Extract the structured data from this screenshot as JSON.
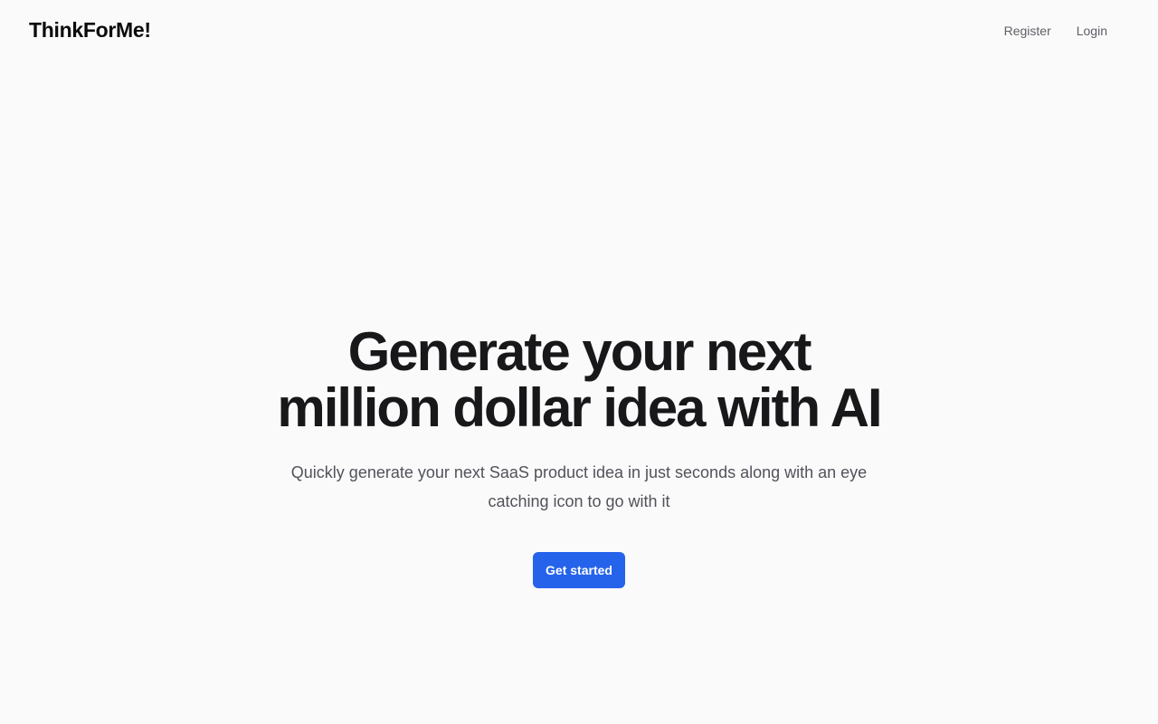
{
  "header": {
    "brand": "ThinkForMe!",
    "nav": {
      "register": "Register",
      "login": "Login"
    }
  },
  "hero": {
    "title": "Generate your next million dollar idea with AI",
    "subtitle": "Quickly generate your next SaaS product idea in just seconds along with an eye catching icon to go with it",
    "cta_label": "Get started"
  },
  "colors": {
    "background": "#fafafa",
    "text": "#18181b",
    "muted": "#52525b",
    "accent": "#2563eb"
  }
}
